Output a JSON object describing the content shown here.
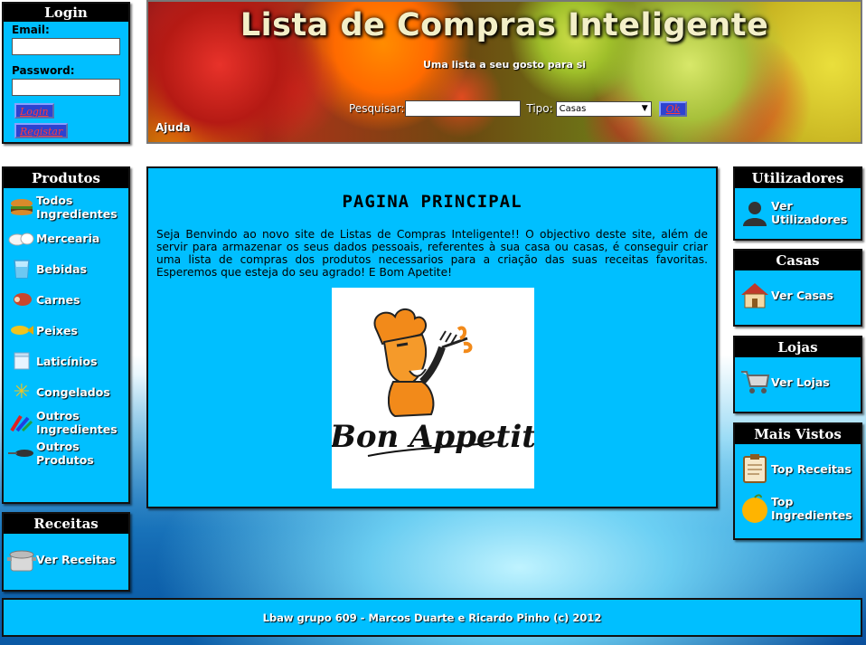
{
  "login": {
    "title": "Login",
    "email_label": "Email:",
    "password_label": "Password:",
    "login_button": "Login",
    "register_button": "Registar"
  },
  "banner": {
    "title": "Lista de Compras Inteligente",
    "subtitle": "Uma lista a seu gosto para si",
    "search_label": "Pesquisar:",
    "type_label": "Tipo:",
    "type_selected": "Casas",
    "ok_button": "Ok",
    "help_link": "Ajuda"
  },
  "produtos": {
    "title": "Produtos",
    "items": [
      {
        "label": "Todos Ingredientes",
        "icon": "burger-icon"
      },
      {
        "label": "Mercearia",
        "icon": "grocery-icon"
      },
      {
        "label": "Bebidas",
        "icon": "glass-icon"
      },
      {
        "label": "Carnes",
        "icon": "meat-icon"
      },
      {
        "label": "Peixes",
        "icon": "fish-icon"
      },
      {
        "label": "Laticínios",
        "icon": "dairy-icon"
      },
      {
        "label": "Congelados",
        "icon": "snowflake-icon"
      },
      {
        "label": "Outros Ingredientes",
        "icon": "candy-icon"
      },
      {
        "label": "Outros Produtos",
        "icon": "pan-icon"
      }
    ]
  },
  "receitas": {
    "title": "Receitas",
    "item": "Ver Receitas"
  },
  "main": {
    "heading": "PAGINA PRINCIPAL",
    "paragraph": "Seja Benvindo ao novo site de Listas de Compras Inteligente!! O objectivo deste site, além de servir para armazenar os seus dados pessoais, referentes à sua casa ou casas, é conseguir criar uma lista de compras dos produtos necessarios para a criação das suas receitas favoritas. Esperemos que esteja do seu agrado! E Bom Apetite!",
    "logo_text": "Bon Appetit"
  },
  "utilizadores": {
    "title": "Utilizadores",
    "item": "Ver Utilizadores"
  },
  "casas": {
    "title": "Casas",
    "item": "Ver Casas"
  },
  "lojas": {
    "title": "Lojas",
    "item": "Ver Lojas"
  },
  "mais_vistos": {
    "title": "Mais Vistos",
    "items": [
      "Top Receitas",
      "Top Ingredientes"
    ]
  },
  "footer": {
    "text": "Lbaw grupo 609 - Marcos Duarte e Ricardo Pinho (c) 2012"
  }
}
